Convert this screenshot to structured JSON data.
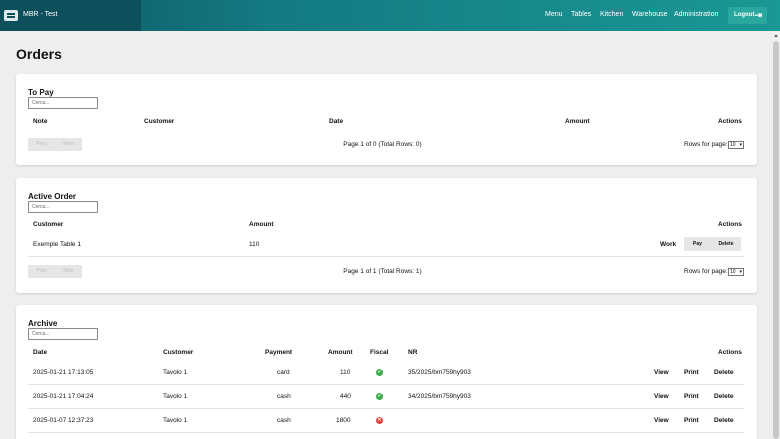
{
  "app": {
    "title": "MBR - Test"
  },
  "nav": {
    "menu": "Menu",
    "tables": "Tables",
    "kitchen": "Kitchen",
    "warehouse": "Warehouse",
    "administration": "Administration",
    "logout": "Logout"
  },
  "page": {
    "title": "Orders"
  },
  "to_pay": {
    "title": "To Pay",
    "search_placeholder": "Cerca...",
    "headers": {
      "note": "Note",
      "customer": "Customer",
      "date": "Date",
      "amount": "Amount",
      "actions": "Actions"
    },
    "prev": "Prev",
    "next": "Next",
    "page_info": "Page 1 of 0 (Total Rows: 0)",
    "rows_label": "Rows for page:",
    "rows_value": "10"
  },
  "active": {
    "title": "Active Order",
    "search_placeholder": "Cerca...",
    "headers": {
      "customer": "Customer",
      "amount": "Amount",
      "actions": "Actions"
    },
    "rows": [
      {
        "customer": "Exemple Table 1",
        "amount": "110",
        "status": "Work",
        "pay": "Pay",
        "delete": "Delete"
      }
    ],
    "prev": "Prev",
    "next": "Next",
    "page_info": "Page 1 of 1 (Total Rows: 1)",
    "rows_label": "Rows for page:",
    "rows_value": "10"
  },
  "archive": {
    "title": "Archive",
    "search_placeholder": "Cerca...",
    "headers": {
      "date": "Date",
      "customer": "Customer",
      "payment": "Payment",
      "amount": "Amount",
      "fiscal": "Fiscal",
      "nr": "NR",
      "actions": "Actions"
    },
    "rows": [
      {
        "date": "2025-01-21 17:13:05",
        "customer": "Tavolo 1",
        "payment": "card",
        "amount": "110",
        "fiscal": "ok",
        "fiscal_icon": "check-icon",
        "nr": "35/2025/bm759hy903",
        "view": "View",
        "print": "Print",
        "delete": "Delete"
      },
      {
        "date": "2025-01-21 17:04:24",
        "customer": "Tavolo 1",
        "payment": "cash",
        "amount": "440",
        "fiscal": "ok",
        "fiscal_icon": "check-icon",
        "nr": "34/2025/bm759hy903",
        "view": "View",
        "print": "Print",
        "delete": "Delete"
      },
      {
        "date": "2025-01-07 12:37:23",
        "customer": "Tavolo 1",
        "payment": "cash",
        "amount": "1800",
        "fiscal": "error",
        "fiscal_icon": "x-icon",
        "nr": "",
        "view": "View",
        "print": "Print",
        "delete": "Delete"
      }
    ]
  },
  "colors": {
    "header_dark": "#0d4f5b",
    "header_accent": "#1a9894",
    "ok": "#3bab4b",
    "error": "#e0443c"
  }
}
